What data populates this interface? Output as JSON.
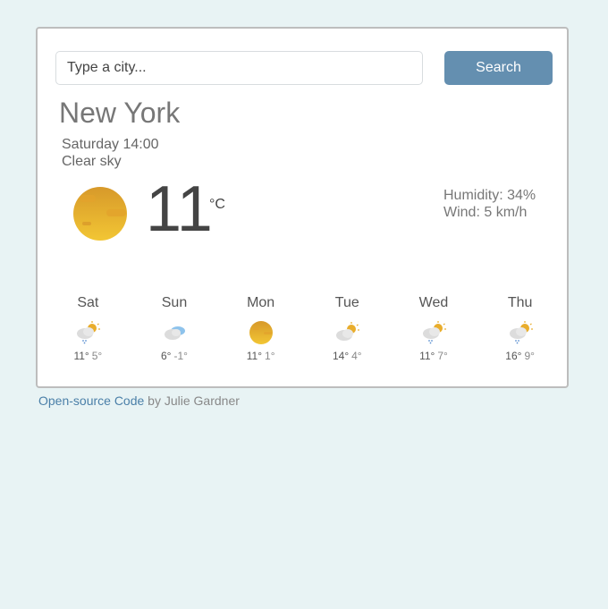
{
  "search": {
    "placeholder": "Type a city...",
    "value": "",
    "button_label": "Search"
  },
  "current": {
    "city": "New York",
    "datetime": "Saturday 14:00",
    "description": "Clear sky",
    "icon": "clear-sky-icon",
    "temperature": "11",
    "unit": "°C",
    "humidity": "Humidity: 34%",
    "wind": "Wind: 5 km/h"
  },
  "forecast": [
    {
      "day": "Sat",
      "icon": "cloud-sun-rain-icon",
      "max": "11°",
      "min": "5°"
    },
    {
      "day": "Sun",
      "icon": "cloud-icon",
      "max": "6°",
      "min": "-1°"
    },
    {
      "day": "Mon",
      "icon": "clear-sky-icon",
      "max": "11°",
      "min": "1°"
    },
    {
      "day": "Tue",
      "icon": "cloud-sun-icon",
      "max": "14°",
      "min": "4°"
    },
    {
      "day": "Wed",
      "icon": "cloud-sun-rain-icon",
      "max": "11°",
      "min": "7°"
    },
    {
      "day": "Thu",
      "icon": "cloud-sun-rain-icon",
      "max": "16°",
      "min": "9°"
    }
  ],
  "footer": {
    "link_text": "Open-source Code",
    "suffix": " by Julie Gardner"
  },
  "colors": {
    "background": "#e8f3f4",
    "button": "#648fb0",
    "link": "#4a7fa8",
    "sun": "#e2a72b"
  }
}
